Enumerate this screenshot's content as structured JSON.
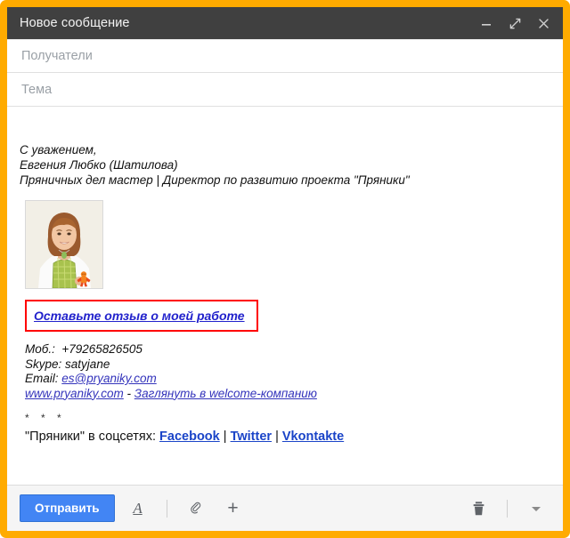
{
  "window": {
    "title": "Новое сообщение",
    "frame_color": "#ffab00",
    "titlebar_color": "#404040",
    "controls": [
      {
        "name": "minimize",
        "icon": "minimize-icon"
      },
      {
        "name": "expand",
        "icon": "expand-icon"
      },
      {
        "name": "close",
        "icon": "close-icon"
      }
    ]
  },
  "fields": {
    "recipients": {
      "placeholder": "Получатели",
      "value": ""
    },
    "subject": {
      "placeholder": "Тема",
      "value": ""
    }
  },
  "body": {
    "signature": [
      "С уважением,",
      "Евгения Любко (Шатилова)",
      "Пряничных дел мастер | Директор по развитию проекта \"Пряники\""
    ],
    "photo": {
      "alt": "Фотография Евгении Любко",
      "name": "signature-photo"
    },
    "review_box": {
      "link_text": "Оставьте отзыв о моей работе",
      "border_color": "#ff0000",
      "link_color": "#2222cc"
    },
    "contacts": [
      {
        "label": "Моб.:",
        "value": "+79265826505",
        "is_link": false
      },
      {
        "label": "Skype:",
        "value": "satyjane",
        "is_link": false
      },
      {
        "label": "Email:",
        "value": "es@pryaniky.com",
        "is_link": true
      }
    ],
    "site_line": {
      "site": "www.pryaniky.com",
      "separator": " - ",
      "cta": "Заглянуть в welcome-компанию"
    },
    "asterisks": "* * *",
    "social": {
      "prefix": "\"Пряники\" в соцсетях:",
      "links": [
        "Facebook",
        "Twitter",
        "Vkontakte"
      ],
      "separator": "|",
      "link_color": "#1a44c8"
    }
  },
  "toolbar": {
    "send_label": "Отправить",
    "send_color": "#4285f4",
    "format_icon": "format-text-icon",
    "attach_icon": "paperclip-icon",
    "insert_icon": "plus-icon",
    "discard_icon": "trash-icon",
    "more_icon": "chevron-down-icon"
  }
}
